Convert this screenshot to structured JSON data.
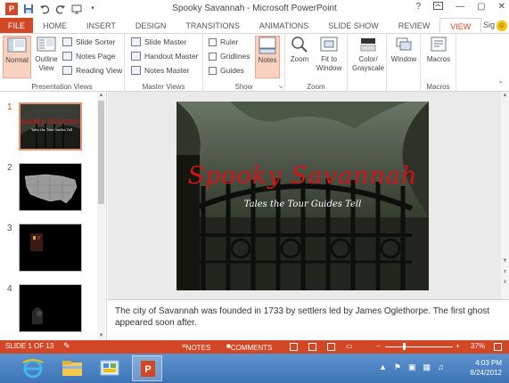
{
  "window": {
    "title": "Spooky Savannah - Microsoft PowerPoint",
    "help": "?",
    "minimize": "—",
    "restore": "▢",
    "close": "✕",
    "app_icon_label": "P"
  },
  "tabs": [
    {
      "label": "FILE"
    },
    {
      "label": "HOME"
    },
    {
      "label": "INSERT"
    },
    {
      "label": "DESIGN"
    },
    {
      "label": "TRANSITIONS"
    },
    {
      "label": "ANIMATIONS"
    },
    {
      "label": "SLIDE SHOW"
    },
    {
      "label": "REVIEW"
    },
    {
      "label": "VIEW"
    }
  ],
  "signin": "Sig",
  "ribbon": {
    "presentation_views": {
      "label": "Presentation Views",
      "normal": "Normal",
      "outline": "Outline View",
      "slide_sorter": "Slide Sorter",
      "notes_page": "Notes Page",
      "reading_view": "Reading View"
    },
    "master_views": {
      "label": "Master Views",
      "slide_master": "Slide Master",
      "handout_master": "Handout Master",
      "notes_master": "Notes Master"
    },
    "show": {
      "label": "Show",
      "ruler": "Ruler",
      "gridlines": "Gridlines",
      "guides": "Guides",
      "notes": "Notes"
    },
    "zoom": {
      "label": "Zoom",
      "zoom": "Zoom",
      "fit": "Fit to Window"
    },
    "color": {
      "label": "Color/ Grayscale"
    },
    "window": {
      "label": "Window"
    },
    "macros": {
      "label": "Macros",
      "button": "Macros"
    }
  },
  "slides": [
    {
      "number": "1"
    },
    {
      "number": "2"
    },
    {
      "number": "3"
    },
    {
      "number": "4"
    }
  ],
  "current_slide": {
    "title": "Spooky Savannah",
    "subtitle": "Tales the Tour Guides Tell"
  },
  "notes_text": "The city of Savannah was founded in 1733 by settlers led by James Oglethorpe. The first ghost appeared soon after.",
  "status": {
    "slide_of": "SLIDE 1 OF 13",
    "notes": "NOTES",
    "comments": "COMMENTS",
    "zoom": "37%",
    "minus": "−",
    "plus": "+"
  },
  "taskbar": {
    "time": "4:03 PM",
    "date": "8/24/2012"
  },
  "colors": {
    "accent": "#d24726",
    "title_red": "#d41414",
    "taskbar": "#4d84c4"
  }
}
